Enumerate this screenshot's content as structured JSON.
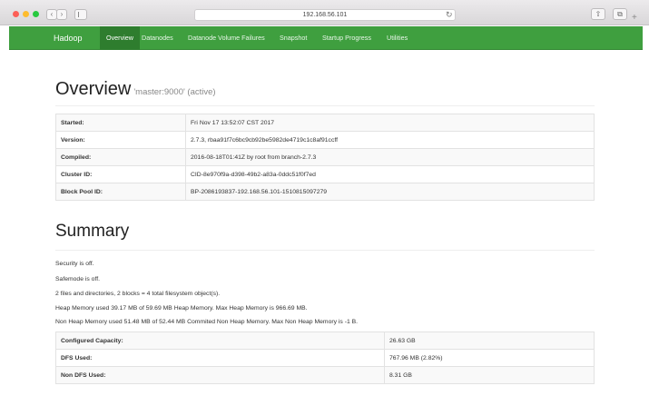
{
  "browser": {
    "url": "192.168.56.101",
    "back_glyph": "‹",
    "forward_glyph": "›",
    "reload_glyph": "↻",
    "share_glyph": "⇧",
    "tabs_glyph": "⧉",
    "new_tab_glyph": "+",
    "traffic_lights": [
      "#fc5f57",
      "#fdbc2e",
      "#28c940"
    ]
  },
  "navbar": {
    "brand": "Hadoop",
    "color": "#3f9f3f",
    "items": [
      {
        "label": "Overview"
      },
      {
        "label": "Datanodes"
      },
      {
        "label": "Datanode Volume Failures"
      },
      {
        "label": "Snapshot"
      },
      {
        "label": "Startup Progress"
      },
      {
        "label": "Utilities"
      }
    ]
  },
  "overview": {
    "title": "Overview",
    "subtitle": "'master:9000' (active)",
    "rows": [
      {
        "key": "Started:",
        "value": "Fri Nov 17 13:52:07 CST 2017"
      },
      {
        "key": "Version:",
        "value": "2.7.3, rbaa91f7c6bc9cb92be5982de4719c1c8af91ccff"
      },
      {
        "key": "Compiled:",
        "value": "2016-08-18T01:41Z by root from branch-2.7.3"
      },
      {
        "key": "Cluster ID:",
        "value": "CID-8e970f9a-d398-49b2-a83a-0ddc51f0f7ed"
      },
      {
        "key": "Block Pool ID:",
        "value": "BP-2086193837-192.168.56.101-1510815097279"
      }
    ]
  },
  "summary": {
    "title": "Summary",
    "lines": [
      "Security is off.",
      "Safemode is off.",
      "2 files and directories, 2 blocks = 4 total filesystem object(s).",
      "Heap Memory used 39.17 MB of 59.69 MB Heap Memory. Max Heap Memory is 966.69 MB.",
      "Non Heap Memory used 51.48 MB of 52.44 MB Commited Non Heap Memory. Max Non Heap Memory is -1 B."
    ],
    "rows": [
      {
        "key": "Configured Capacity:",
        "value": "26.63 GB"
      },
      {
        "key": "DFS Used:",
        "value": "767.96 MB (2.82%)"
      },
      {
        "key": "Non DFS Used:",
        "value": "8.31 GB"
      }
    ]
  }
}
